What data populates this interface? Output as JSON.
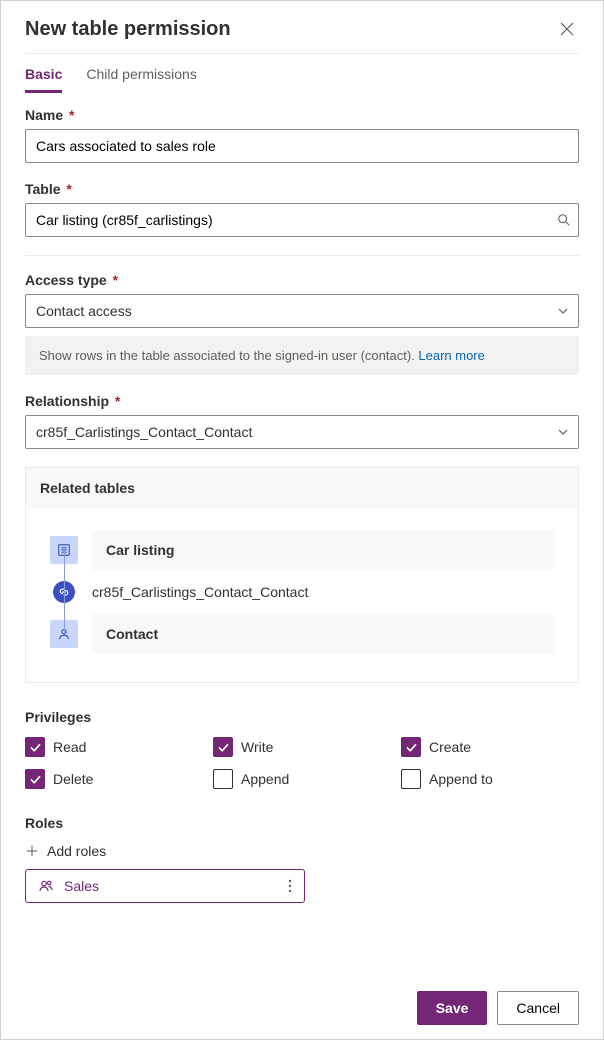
{
  "header": {
    "title": "New table permission"
  },
  "tabs": {
    "basic": "Basic",
    "child": "Child permissions"
  },
  "fields": {
    "name_label": "Name",
    "name_value": "Cars associated to sales role",
    "table_label": "Table",
    "table_value": "Car listing (cr85f_carlistings)",
    "access_label": "Access type",
    "access_value": "Contact access",
    "access_info_prefix": "Show rows in the table associated to the signed-in user (contact). ",
    "access_info_link": "Learn more",
    "relationship_label": "Relationship",
    "relationship_value": "cr85f_Carlistings_Contact_Contact"
  },
  "related": {
    "heading": "Related tables",
    "table1": "Car listing",
    "link": "cr85f_Carlistings_Contact_Contact",
    "table2": "Contact"
  },
  "privileges": {
    "heading": "Privileges",
    "items": [
      {
        "label": "Read",
        "checked": true
      },
      {
        "label": "Write",
        "checked": true
      },
      {
        "label": "Create",
        "checked": true
      },
      {
        "label": "Delete",
        "checked": true
      },
      {
        "label": "Append",
        "checked": false
      },
      {
        "label": "Append to",
        "checked": false
      }
    ]
  },
  "roles": {
    "heading": "Roles",
    "add": "Add roles",
    "chip": "Sales"
  },
  "footer": {
    "save": "Save",
    "cancel": "Cancel"
  }
}
